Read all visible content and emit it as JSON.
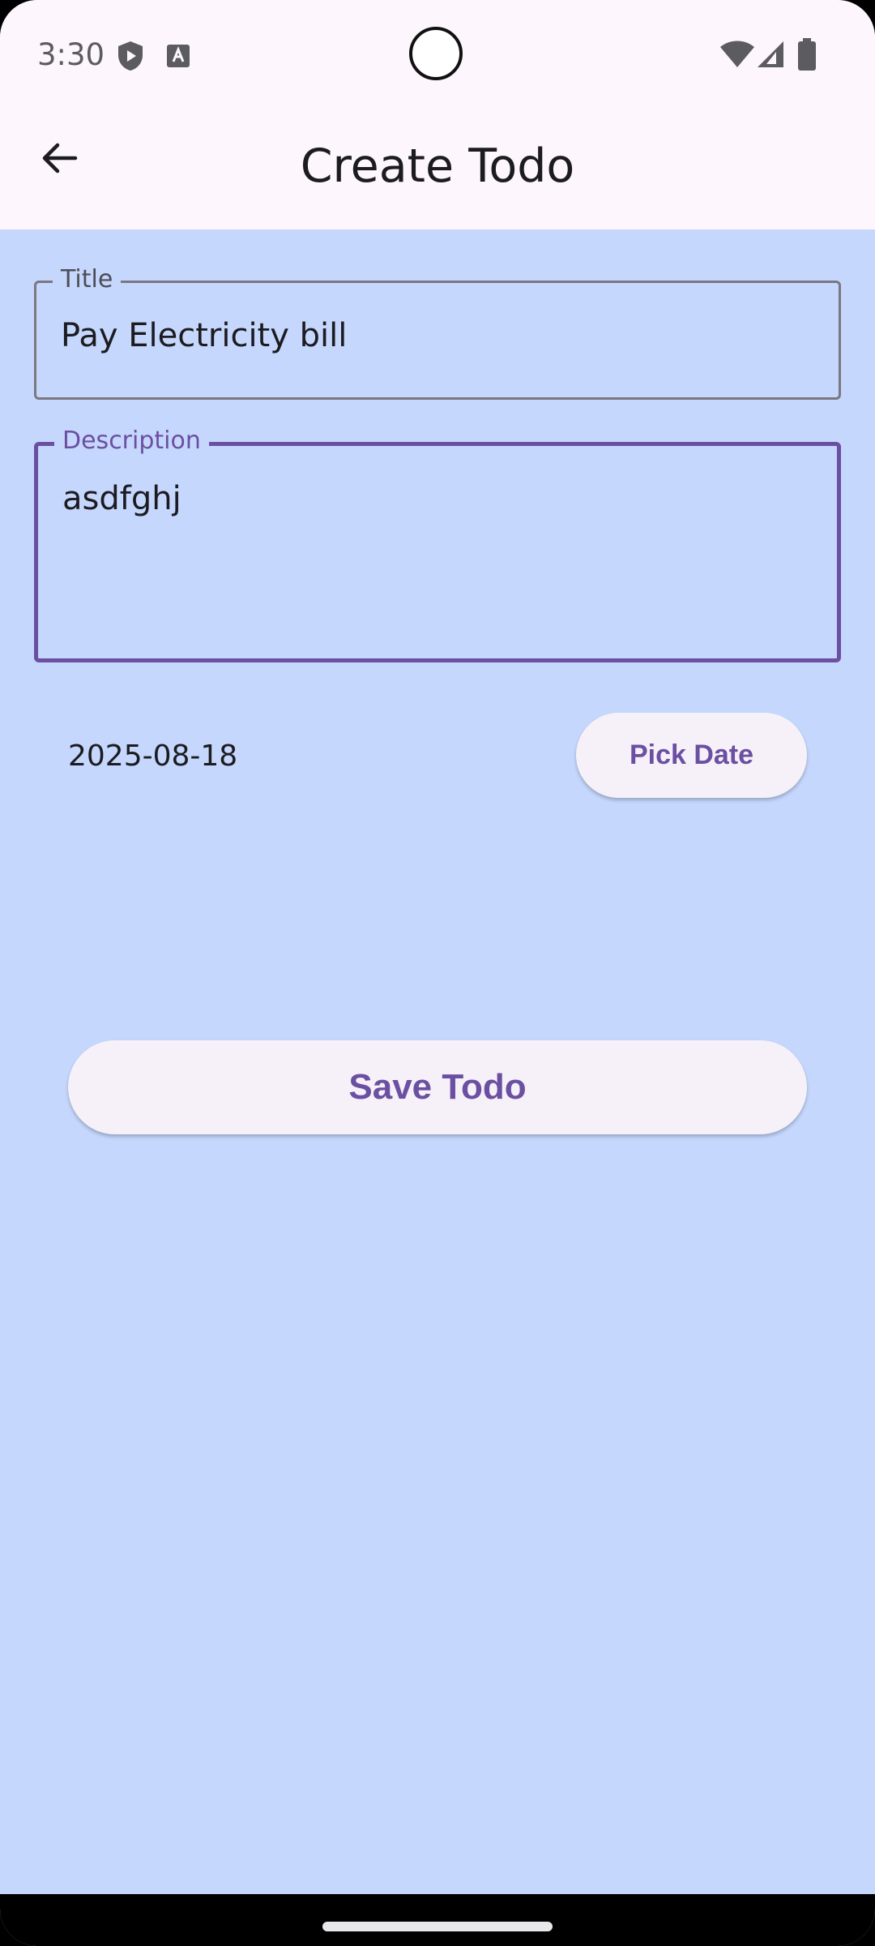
{
  "status_bar": {
    "time": "3:30",
    "icons": [
      "shield-play-icon",
      "text-a-icon",
      "wifi-icon",
      "signal-icon",
      "battery-icon"
    ]
  },
  "app_bar": {
    "title": "Create Todo",
    "back_icon": "arrow-back-icon"
  },
  "form": {
    "title_label": "Title",
    "title_value": "Pay Electricity bill",
    "description_label": "Description",
    "description_value": "asdfghj",
    "date_value": "2025-08-18",
    "pick_date_label": "Pick Date",
    "save_label": "Save Todo"
  },
  "colors": {
    "background": "#c5d7fd",
    "app_bar": "#fdf6fd",
    "accent": "#6b4fa2",
    "button_bg": "#f6f1f8"
  }
}
